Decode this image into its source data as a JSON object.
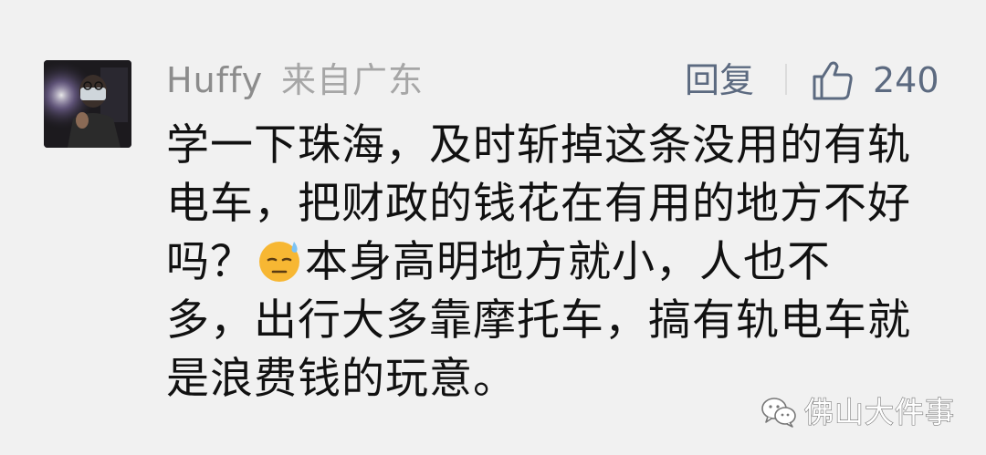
{
  "comment": {
    "author": {
      "name": "Huffy",
      "location": "来自广东"
    },
    "actions": {
      "reply_label": "回复",
      "like_count": "240"
    },
    "lines": [
      "学一下珠海，及时斩掉这条没用的有轨",
      "电车，把财政的钱花在有用的地方不好",
      "吗？",
      "本身高明地方就小，人也不",
      "多，出行大多靠摩托车，搞有轨电车就",
      "是浪费钱的玩意。"
    ],
    "emoji": "sweat-face-emoji"
  },
  "watermark": {
    "icon": "wechat-icon",
    "text": "佛山大件事"
  },
  "colors": {
    "background": "#f1f1f1",
    "username": "#8c8c8c",
    "action": "#5c6a80",
    "body_text": "#111111",
    "emoji_face": "#f7b733"
  }
}
